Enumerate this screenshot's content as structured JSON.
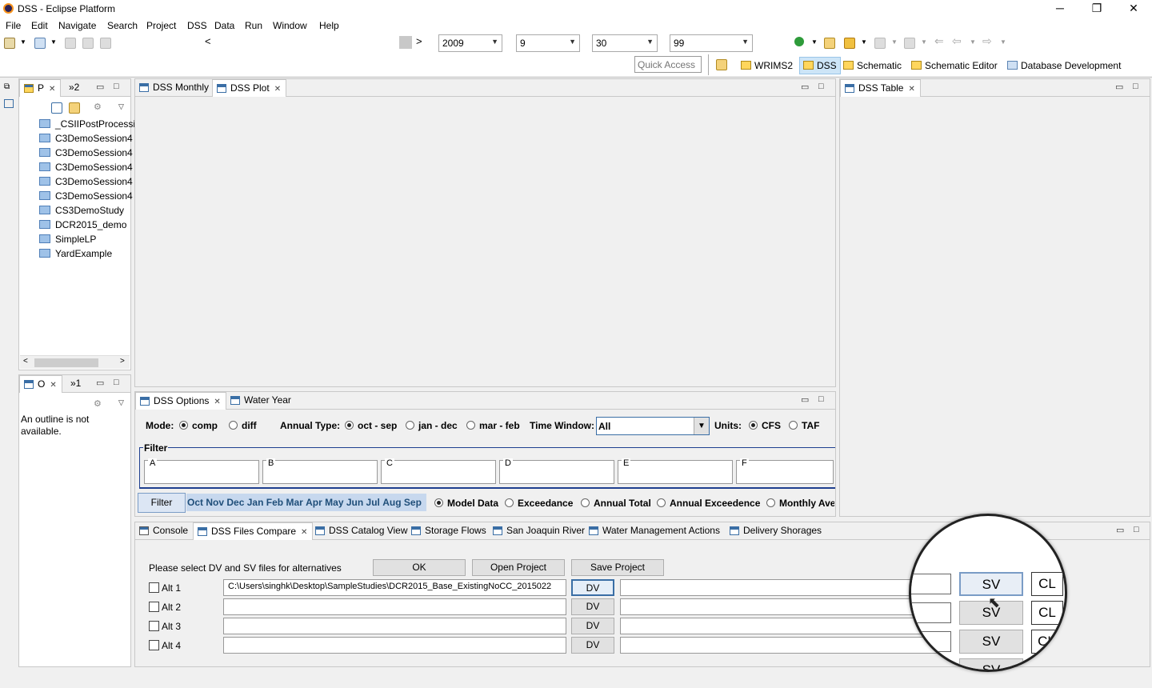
{
  "window": {
    "title": "DSS - Eclipse Platform",
    "minimize": "─",
    "restore": "❐",
    "close": "✕"
  },
  "menu": [
    "File",
    "Edit",
    "Navigate",
    "Search",
    "Project",
    "DSS",
    "Data",
    "Run",
    "Window",
    "Help"
  ],
  "toolbar": {
    "year": "2009",
    "month": "9",
    "day": "30",
    "value": "99",
    "quick_access_placeholder": "Quick Access",
    "nav_back": "<",
    "nav_fwd": ">"
  },
  "perspectives": [
    "WRIMS2",
    "DSS",
    "Schematic",
    "Schematic Editor",
    "Database Development"
  ],
  "project_panel": {
    "tab1": "P",
    "tab2": "»2",
    "items": [
      "_CSIIPostProcessi",
      "C3DemoSession4",
      "C3DemoSession4",
      "C3DemoSession4",
      "C3DemoSession4",
      "C3DemoSession4",
      "CS3DemoStudy",
      "DCR2015_demo",
      "SimpleLP",
      "YardExample"
    ]
  },
  "outline_panel": {
    "tab1": "O",
    "tab2": "»1",
    "message": "An outline is not available."
  },
  "editor_tabs": [
    "DSS Monthly",
    "DSS Plot"
  ],
  "table_tab": "DSS Table",
  "options": {
    "tabs": [
      "DSS Options",
      "Water Year"
    ],
    "mode_label": "Mode:",
    "mode_comp": "comp",
    "mode_diff": "diff",
    "annual_type_label": "Annual Type:",
    "annual_octsep": "oct - sep",
    "annual_jandec": "jan - dec",
    "annual_marfeb": "mar - feb",
    "time_window_label": "Time Window:",
    "time_window_value": "All",
    "units_label": "Units:",
    "units_cfs": "CFS",
    "units_taf": "TAF",
    "filter_title": "Filter",
    "filter_parts": [
      "A",
      "B",
      "C",
      "D",
      "E",
      "F"
    ],
    "filter_button": "Filter",
    "months": [
      "Oct",
      "Nov",
      "Dec",
      "Jan",
      "Feb",
      "Mar",
      "Apr",
      "May",
      "Jun",
      "Jul",
      "Aug",
      "Sep"
    ],
    "view_options": [
      "Model Data",
      "Exceedance",
      "Annual Total",
      "Annual Exceedence",
      "Monthly Ave"
    ]
  },
  "bottom_tabs": [
    "Console",
    "DSS Files Compare",
    "DSS Catalog View",
    "Storage Flows",
    "San Joaquin River",
    "Water Management Actions",
    "Delivery Shorages"
  ],
  "compare": {
    "instruction": "Please select DV and SV files for alternatives",
    "ok": "OK",
    "open_project": "Open Project",
    "save_project": "Save Project",
    "rows": [
      {
        "label": "Alt 1",
        "dv_path": "C:\\Users\\singhk\\Desktop\\SampleStudies\\DCR2015_Base_ExistingNoCC_2015022"
      },
      {
        "label": "Alt 2",
        "dv_path": ""
      },
      {
        "label": "Alt 3",
        "dv_path": ""
      },
      {
        "label": "Alt 4",
        "dv_path": ""
      }
    ],
    "dv": "DV",
    "sv": "SV",
    "cl": "CL"
  }
}
